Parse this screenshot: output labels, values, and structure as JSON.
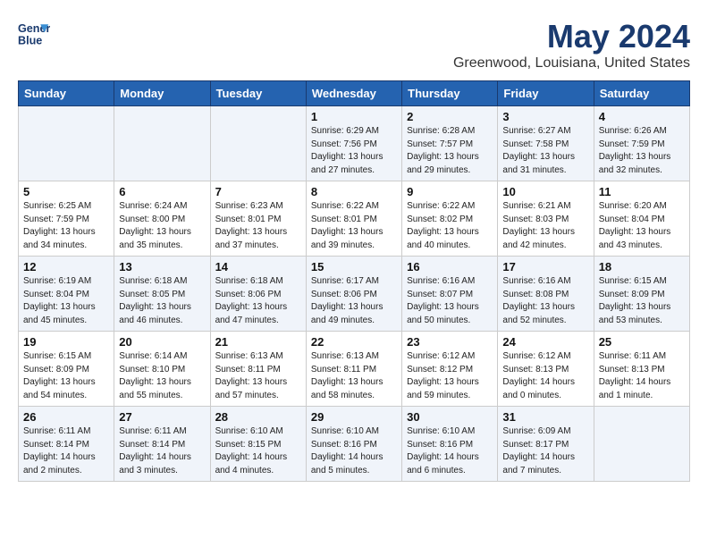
{
  "header": {
    "logo_line1": "General",
    "logo_line2": "Blue",
    "month_year": "May 2024",
    "location": "Greenwood, Louisiana, United States"
  },
  "days_of_week": [
    "Sunday",
    "Monday",
    "Tuesday",
    "Wednesday",
    "Thursday",
    "Friday",
    "Saturday"
  ],
  "weeks": [
    [
      {
        "day": "",
        "info": ""
      },
      {
        "day": "",
        "info": ""
      },
      {
        "day": "",
        "info": ""
      },
      {
        "day": "1",
        "info": "Sunrise: 6:29 AM\nSunset: 7:56 PM\nDaylight: 13 hours\nand 27 minutes."
      },
      {
        "day": "2",
        "info": "Sunrise: 6:28 AM\nSunset: 7:57 PM\nDaylight: 13 hours\nand 29 minutes."
      },
      {
        "day": "3",
        "info": "Sunrise: 6:27 AM\nSunset: 7:58 PM\nDaylight: 13 hours\nand 31 minutes."
      },
      {
        "day": "4",
        "info": "Sunrise: 6:26 AM\nSunset: 7:59 PM\nDaylight: 13 hours\nand 32 minutes."
      }
    ],
    [
      {
        "day": "5",
        "info": "Sunrise: 6:25 AM\nSunset: 7:59 PM\nDaylight: 13 hours\nand 34 minutes."
      },
      {
        "day": "6",
        "info": "Sunrise: 6:24 AM\nSunset: 8:00 PM\nDaylight: 13 hours\nand 35 minutes."
      },
      {
        "day": "7",
        "info": "Sunrise: 6:23 AM\nSunset: 8:01 PM\nDaylight: 13 hours\nand 37 minutes."
      },
      {
        "day": "8",
        "info": "Sunrise: 6:22 AM\nSunset: 8:01 PM\nDaylight: 13 hours\nand 39 minutes."
      },
      {
        "day": "9",
        "info": "Sunrise: 6:22 AM\nSunset: 8:02 PM\nDaylight: 13 hours\nand 40 minutes."
      },
      {
        "day": "10",
        "info": "Sunrise: 6:21 AM\nSunset: 8:03 PM\nDaylight: 13 hours\nand 42 minutes."
      },
      {
        "day": "11",
        "info": "Sunrise: 6:20 AM\nSunset: 8:04 PM\nDaylight: 13 hours\nand 43 minutes."
      }
    ],
    [
      {
        "day": "12",
        "info": "Sunrise: 6:19 AM\nSunset: 8:04 PM\nDaylight: 13 hours\nand 45 minutes."
      },
      {
        "day": "13",
        "info": "Sunrise: 6:18 AM\nSunset: 8:05 PM\nDaylight: 13 hours\nand 46 minutes."
      },
      {
        "day": "14",
        "info": "Sunrise: 6:18 AM\nSunset: 8:06 PM\nDaylight: 13 hours\nand 47 minutes."
      },
      {
        "day": "15",
        "info": "Sunrise: 6:17 AM\nSunset: 8:06 PM\nDaylight: 13 hours\nand 49 minutes."
      },
      {
        "day": "16",
        "info": "Sunrise: 6:16 AM\nSunset: 8:07 PM\nDaylight: 13 hours\nand 50 minutes."
      },
      {
        "day": "17",
        "info": "Sunrise: 6:16 AM\nSunset: 8:08 PM\nDaylight: 13 hours\nand 52 minutes."
      },
      {
        "day": "18",
        "info": "Sunrise: 6:15 AM\nSunset: 8:09 PM\nDaylight: 13 hours\nand 53 minutes."
      }
    ],
    [
      {
        "day": "19",
        "info": "Sunrise: 6:15 AM\nSunset: 8:09 PM\nDaylight: 13 hours\nand 54 minutes."
      },
      {
        "day": "20",
        "info": "Sunrise: 6:14 AM\nSunset: 8:10 PM\nDaylight: 13 hours\nand 55 minutes."
      },
      {
        "day": "21",
        "info": "Sunrise: 6:13 AM\nSunset: 8:11 PM\nDaylight: 13 hours\nand 57 minutes."
      },
      {
        "day": "22",
        "info": "Sunrise: 6:13 AM\nSunset: 8:11 PM\nDaylight: 13 hours\nand 58 minutes."
      },
      {
        "day": "23",
        "info": "Sunrise: 6:12 AM\nSunset: 8:12 PM\nDaylight: 13 hours\nand 59 minutes."
      },
      {
        "day": "24",
        "info": "Sunrise: 6:12 AM\nSunset: 8:13 PM\nDaylight: 14 hours\nand 0 minutes."
      },
      {
        "day": "25",
        "info": "Sunrise: 6:11 AM\nSunset: 8:13 PM\nDaylight: 14 hours\nand 1 minute."
      }
    ],
    [
      {
        "day": "26",
        "info": "Sunrise: 6:11 AM\nSunset: 8:14 PM\nDaylight: 14 hours\nand 2 minutes."
      },
      {
        "day": "27",
        "info": "Sunrise: 6:11 AM\nSunset: 8:14 PM\nDaylight: 14 hours\nand 3 minutes."
      },
      {
        "day": "28",
        "info": "Sunrise: 6:10 AM\nSunset: 8:15 PM\nDaylight: 14 hours\nand 4 minutes."
      },
      {
        "day": "29",
        "info": "Sunrise: 6:10 AM\nSunset: 8:16 PM\nDaylight: 14 hours\nand 5 minutes."
      },
      {
        "day": "30",
        "info": "Sunrise: 6:10 AM\nSunset: 8:16 PM\nDaylight: 14 hours\nand 6 minutes."
      },
      {
        "day": "31",
        "info": "Sunrise: 6:09 AM\nSunset: 8:17 PM\nDaylight: 14 hours\nand 7 minutes."
      },
      {
        "day": "",
        "info": ""
      }
    ]
  ]
}
